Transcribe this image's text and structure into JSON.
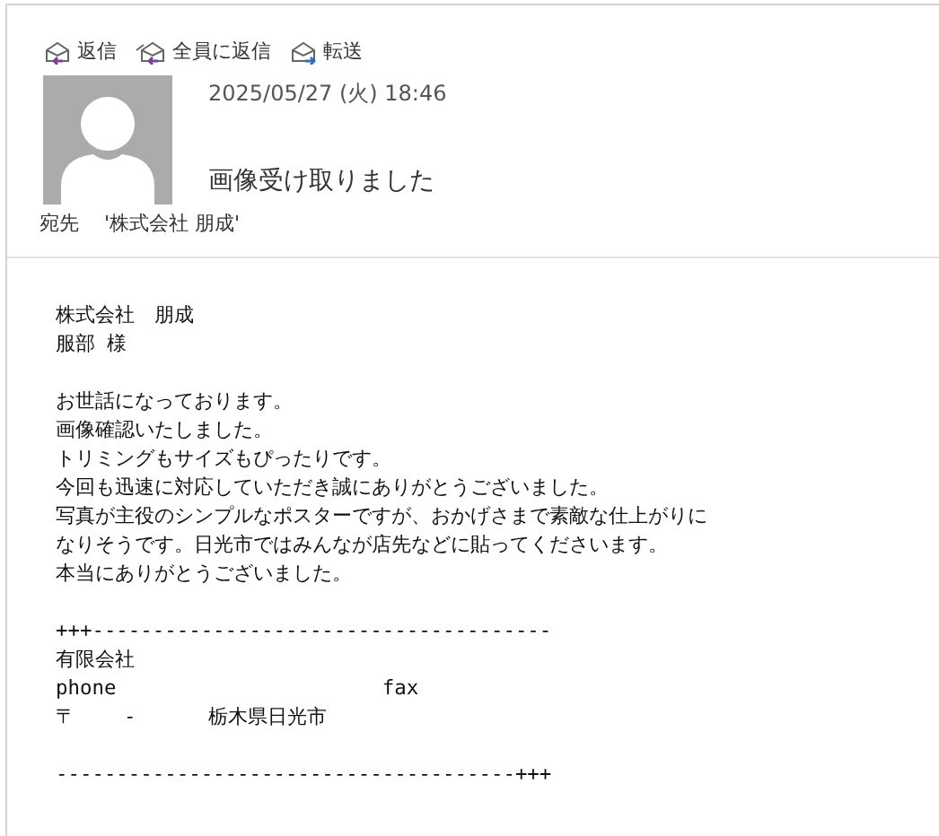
{
  "toolbar": [
    {
      "label": "返信",
      "kind": "reply"
    },
    {
      "label": "全員に返信",
      "kind": "reply-all"
    },
    {
      "label": "転送",
      "kind": "forward"
    }
  ],
  "message": {
    "date": "2025/05/27 (火) 18:46",
    "subject": "画像受け取りました",
    "to_label": "宛先",
    "to": "'株式会社  朋成'"
  },
  "body": [
    [
      "株式会社　朋成",
      "服部 様"
    ],
    [
      "お世話になっております。",
      "画像確認いたしました。",
      "トリミングもサイズもぴったりです。",
      "今回も迅速に対応していただき誠にありがとうございました。",
      "写真が主役のシンプルなポスターですが、おかげさまで素敵な仕上がりに",
      "なりそうです。日光市ではみんなが店先などに貼ってくださいます。",
      "本当にありがとうございました。"
    ],
    [
      "+++--------------------------------------",
      "有限会社",
      "phone                      fax",
      "〒    -      栃木県日光市"
    ],
    [
      "--------------------------------------+++"
    ]
  ]
}
